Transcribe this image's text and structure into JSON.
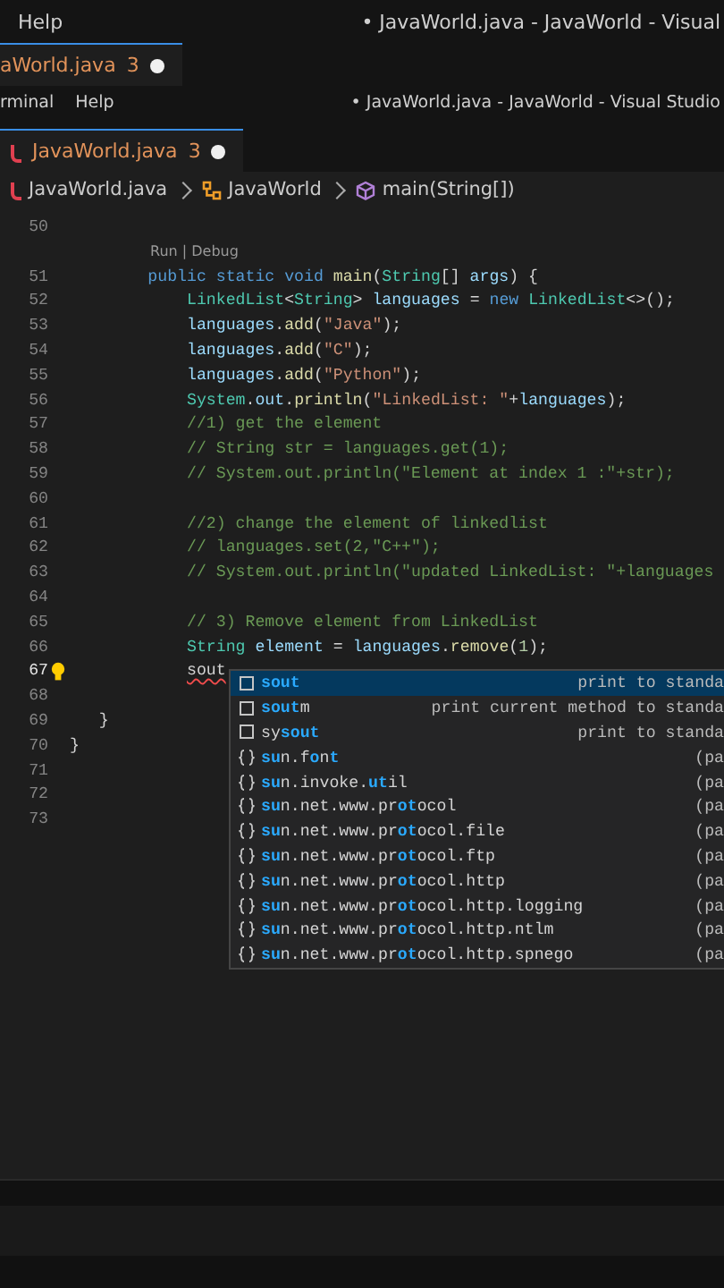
{
  "back_window": {
    "menu": [
      "Help"
    ],
    "title": "• JavaWorld.java - JavaWorld - Visual",
    "tab": {
      "label": "aWorld.java",
      "problems": "3",
      "modified": true,
      "selected": true
    }
  },
  "window": {
    "menu": [
      "rminal",
      "Help"
    ],
    "title": "• JavaWorld.java - JavaWorld - Visual Studio"
  },
  "tabs": [
    {
      "label": "JavaWorld.java",
      "problems": "3",
      "modified": true,
      "selected": true
    }
  ],
  "breadcrumbs": [
    {
      "kind": "file",
      "label": "JavaWorld.java"
    },
    {
      "kind": "class",
      "label": "JavaWorld"
    },
    {
      "kind": "method",
      "label": "main(String[])"
    }
  ],
  "editor": {
    "lines": [
      {
        "kind": "code",
        "number": "50"
      },
      {
        "kind": "codelens",
        "text": "Run | Debug"
      },
      {
        "kind": "code",
        "number": "51",
        "tokens": [
          {
            "t": "        public static void ",
            "kind": "kw"
          },
          {
            "t": "main",
            "kind": "fn"
          },
          {
            "t": "("
          },
          {
            "t": "String",
            "kind": "type"
          },
          {
            "t": "[] "
          },
          {
            "t": "args",
            "kind": "var"
          },
          {
            "t": ") {"
          }
        ]
      },
      {
        "kind": "code",
        "number": "52",
        "tokens": [
          {
            "t": "            LinkedList",
            "kind": "type"
          },
          {
            "t": "<"
          },
          {
            "t": "String",
            "kind": "type"
          },
          {
            "t": "> "
          },
          {
            "t": "languages",
            "kind": "var"
          },
          {
            "t": " = "
          },
          {
            "t": "new ",
            "kind": "kw"
          },
          {
            "t": "LinkedList",
            "kind": "type"
          },
          {
            "t": "<>();"
          }
        ]
      },
      {
        "kind": "code",
        "number": "53",
        "tokens": [
          {
            "t": "            languages",
            "kind": "var"
          },
          {
            "t": "."
          },
          {
            "t": "add",
            "kind": "fn"
          },
          {
            "t": "("
          },
          {
            "t": "\"Java\"",
            "kind": "str"
          },
          {
            "t": ");"
          }
        ]
      },
      {
        "kind": "code",
        "number": "54",
        "tokens": [
          {
            "t": "            languages",
            "kind": "var"
          },
          {
            "t": "."
          },
          {
            "t": "add",
            "kind": "fn"
          },
          {
            "t": "("
          },
          {
            "t": "\"C\"",
            "kind": "str"
          },
          {
            "t": ");"
          }
        ]
      },
      {
        "kind": "code",
        "number": "55",
        "tokens": [
          {
            "t": "            languages",
            "kind": "var"
          },
          {
            "t": "."
          },
          {
            "t": "add",
            "kind": "fn"
          },
          {
            "t": "("
          },
          {
            "t": "\"Python\"",
            "kind": "str"
          },
          {
            "t": ");"
          }
        ]
      },
      {
        "kind": "code",
        "number": "56",
        "tokens": [
          {
            "t": "            System",
            "kind": "type"
          },
          {
            "t": "."
          },
          {
            "t": "out",
            "kind": "var"
          },
          {
            "t": "."
          },
          {
            "t": "println",
            "kind": "fn"
          },
          {
            "t": "("
          },
          {
            "t": "\"LinkedList: \"",
            "kind": "str"
          },
          {
            "t": "+"
          },
          {
            "t": "languages",
            "kind": "var"
          },
          {
            "t": ");"
          }
        ]
      },
      {
        "kind": "code",
        "number": "57",
        "tokens": [
          {
            "t": "            //1) get the element",
            "kind": "cmt"
          }
        ]
      },
      {
        "kind": "code",
        "number": "58",
        "tokens": [
          {
            "t": "            // String str = languages.get(1);",
            "kind": "cmt"
          }
        ]
      },
      {
        "kind": "code",
        "number": "59",
        "tokens": [
          {
            "t": "            // System.out.println(\"Element at index 1 :\"+str);",
            "kind": "cmt"
          }
        ]
      },
      {
        "kind": "code",
        "number": "60"
      },
      {
        "kind": "code",
        "number": "61",
        "tokens": [
          {
            "t": "            //2) change the element of linkedlist",
            "kind": "cmt"
          }
        ]
      },
      {
        "kind": "code",
        "number": "62",
        "tokens": [
          {
            "t": "            // languages.set(2,\"C++\");",
            "kind": "cmt"
          }
        ]
      },
      {
        "kind": "code",
        "number": "63",
        "tokens": [
          {
            "t": "            // System.out.println(\"updated LinkedList: \"+languages",
            "kind": "cmt"
          }
        ]
      },
      {
        "kind": "code",
        "number": "64"
      },
      {
        "kind": "code",
        "number": "65",
        "tokens": [
          {
            "t": "            // 3) Remove element from LinkedList",
            "kind": "cmt"
          }
        ]
      },
      {
        "kind": "code",
        "number": "66",
        "tokens": [
          {
            "t": "            String",
            "kind": "type"
          },
          {
            "t": " element",
            "kind": "var"
          },
          {
            "t": " = "
          },
          {
            "t": "languages",
            "kind": "var"
          },
          {
            "t": "."
          },
          {
            "t": "remove",
            "kind": "fn"
          },
          {
            "t": "("
          },
          {
            "t": "1",
            "kind": "num"
          },
          {
            "t": ");"
          }
        ]
      },
      {
        "kind": "code",
        "number": "67",
        "current": true,
        "lightbulb": true,
        "tokens": [
          {
            "t": "            sout",
            "kind": "err"
          }
        ]
      },
      {
        "kind": "code",
        "number": "68"
      },
      {
        "kind": "code",
        "number": "69",
        "tokens": [
          {
            "t": "   }"
          }
        ]
      },
      {
        "kind": "code",
        "number": "70",
        "tokens": [
          {
            "t": "}"
          }
        ]
      },
      {
        "kind": "code",
        "number": "71"
      },
      {
        "kind": "code",
        "number": "72"
      },
      {
        "kind": "code",
        "number": "73"
      }
    ]
  },
  "suggestions": [
    {
      "kind": "snippet",
      "selected": true,
      "label": [
        {
          "t": "sout",
          "match": true
        }
      ],
      "detail": "print to standa"
    },
    {
      "kind": "snippet",
      "selected": false,
      "label": [
        {
          "t": "sout",
          "match": true
        },
        {
          "t": "m"
        }
      ],
      "detail": "print current method to standa"
    },
    {
      "kind": "snippet",
      "selected": false,
      "label": [
        {
          "t": "sy"
        },
        {
          "t": "sout",
          "match": true
        }
      ],
      "detail": "print to standa"
    },
    {
      "kind": "module",
      "selected": false,
      "label": [
        {
          "t": "su",
          "match": true
        },
        {
          "t": "n.f"
        },
        {
          "t": "o",
          "match": true
        },
        {
          "t": "n"
        },
        {
          "t": "t",
          "match": true
        }
      ],
      "detail": "(pa"
    },
    {
      "kind": "module",
      "selected": false,
      "label": [
        {
          "t": "su",
          "match": true
        },
        {
          "t": "n.invoke."
        },
        {
          "t": "ut",
          "match": true
        },
        {
          "t": "il"
        }
      ],
      "detail": "(pa"
    },
    {
      "kind": "module",
      "selected": false,
      "label": [
        {
          "t": "su",
          "match": true
        },
        {
          "t": "n.net.www.pr"
        },
        {
          "t": "ot",
          "match": true
        },
        {
          "t": "ocol"
        }
      ],
      "detail": "(pa"
    },
    {
      "kind": "module",
      "selected": false,
      "label": [
        {
          "t": "su",
          "match": true
        },
        {
          "t": "n.net.www.pr"
        },
        {
          "t": "ot",
          "match": true
        },
        {
          "t": "ocol.file"
        }
      ],
      "detail": "(pa"
    },
    {
      "kind": "module",
      "selected": false,
      "label": [
        {
          "t": "su",
          "match": true
        },
        {
          "t": "n.net.www.pr"
        },
        {
          "t": "ot",
          "match": true
        },
        {
          "t": "ocol.ftp"
        }
      ],
      "detail": "(pa"
    },
    {
      "kind": "module",
      "selected": false,
      "label": [
        {
          "t": "su",
          "match": true
        },
        {
          "t": "n.net.www.pr"
        },
        {
          "t": "ot",
          "match": true
        },
        {
          "t": "ocol.http"
        }
      ],
      "detail": "(pa"
    },
    {
      "kind": "module",
      "selected": false,
      "label": [
        {
          "t": "su",
          "match": true
        },
        {
          "t": "n.net.www.pr"
        },
        {
          "t": "ot",
          "match": true
        },
        {
          "t": "ocol.http.logging"
        }
      ],
      "detail": "(pa"
    },
    {
      "kind": "module",
      "selected": false,
      "label": [
        {
          "t": "su",
          "match": true
        },
        {
          "t": "n.net.www.pr"
        },
        {
          "t": "ot",
          "match": true
        },
        {
          "t": "ocol.http.ntlm"
        }
      ],
      "detail": "(pa"
    },
    {
      "kind": "module",
      "selected": false,
      "label": [
        {
          "t": "su",
          "match": true
        },
        {
          "t": "n.net.www.pr"
        },
        {
          "t": "ot",
          "match": true
        },
        {
          "t": "ocol.http.spnego"
        }
      ],
      "detail": "(pa"
    }
  ]
}
